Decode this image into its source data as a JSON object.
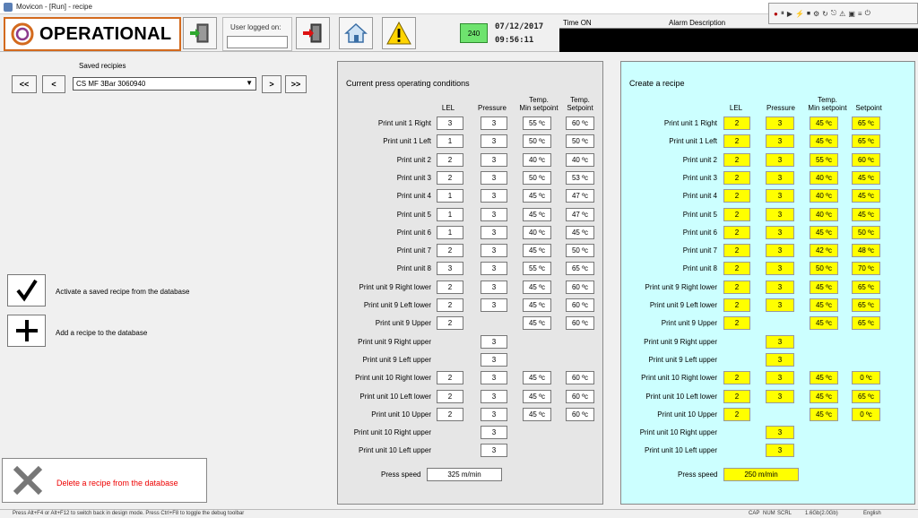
{
  "window": {
    "title": "Movicon - [Run] - recipe"
  },
  "header": {
    "status": "OPERATIONAL",
    "user_label": "User logged on:",
    "user_value": "",
    "code": "240",
    "date": "07/12/2017",
    "time": "09:56:11",
    "alarm_time_header": "Time ON",
    "alarm_desc_header": "Alarm Description"
  },
  "debug": {
    "items": [
      "●",
      "⏸",
      "▶",
      "⚡",
      "⏹",
      "⚙",
      "↻",
      "⎋",
      "⚠",
      "▣",
      "≡",
      "⏻"
    ]
  },
  "icons": {
    "logo": "swirl-logo-icon",
    "login": "login-door-icon",
    "logout": "logout-door-icon",
    "home": "home-icon",
    "alarm": "warning-triangle-icon",
    "check": "checkmark-icon",
    "add": "plus-icon",
    "delete": "cross-icon"
  },
  "colors": {
    "accent": "#d36a1e",
    "code_bg": "#6ee36e",
    "recipe_panel": "#ccffff",
    "recipe_cell": "#ffff00",
    "delete_text": "#e00000"
  },
  "recipes": {
    "saved_label": "Saved recipies",
    "selected": "CS MF 3Bar 3060940",
    "nav": {
      "first": "<<",
      "prev": "<",
      "next": ">",
      "last": ">>"
    }
  },
  "actions": {
    "activate": "Activate a saved recipe from the database",
    "add": "Add a recipe to the database",
    "delete": "Delete a recipe from the database"
  },
  "current": {
    "title": "Current press operating conditions",
    "columns": [
      "LEL",
      "Pressure",
      "Temp.\nMin setpoint",
      "Temp.\nSetpoint"
    ],
    "rows": [
      {
        "label": "Print unit 1 Right",
        "lel": "3",
        "pressure": "3",
        "min": "55 ºc",
        "set": "60 ºc"
      },
      {
        "label": "Print unit 1 Left",
        "lel": "1",
        "pressure": "3",
        "min": "50 ºc",
        "set": "50 ºc"
      },
      {
        "label": "Print unit 2",
        "lel": "2",
        "pressure": "3",
        "min": "40 ºc",
        "set": "40 ºc"
      },
      {
        "label": "Print unit 3",
        "lel": "2",
        "pressure": "3",
        "min": "50 ºc",
        "set": "53 ºc"
      },
      {
        "label": "Print unit 4",
        "lel": "1",
        "pressure": "3",
        "min": "45 ºc",
        "set": "47 ºc"
      },
      {
        "label": "Print unit 5",
        "lel": "1",
        "pressure": "3",
        "min": "45 ºc",
        "set": "47 ºc"
      },
      {
        "label": "Print unit 6",
        "lel": "1",
        "pressure": "3",
        "min": "40 ºc",
        "set": "45 ºc"
      },
      {
        "label": "Print unit 7",
        "lel": "2",
        "pressure": "3",
        "min": "45 ºc",
        "set": "50 ºc"
      },
      {
        "label": "Print unit 8",
        "lel": "3",
        "pressure": "3",
        "min": "55 ºc",
        "set": "65 ºc"
      },
      {
        "label": "Print unit 9 Right lower",
        "lel": "2",
        "pressure": "3",
        "min": "45 ºc",
        "set": "60 ºc"
      },
      {
        "label": "Print unit 9 Left lower",
        "lel": "2",
        "pressure": "3",
        "min": "45 ºc",
        "set": "60 ºc"
      },
      {
        "label": "Print unit 9 Upper",
        "lel": "2",
        "pressure": null,
        "min": "45 ºc",
        "set": "60 ºc"
      },
      {
        "label": "Print unit 9 Right upper",
        "lel": null,
        "pressure": "3",
        "min": null,
        "set": null
      },
      {
        "label": "Print unit 9 Left upper",
        "lel": null,
        "pressure": "3",
        "min": null,
        "set": null
      },
      {
        "label": "Print unit 10 Right lower",
        "lel": "2",
        "pressure": "3",
        "min": "45 ºc",
        "set": "60 ºc"
      },
      {
        "label": "Print unit 10 Left lower",
        "lel": "2",
        "pressure": "3",
        "min": "45 ºc",
        "set": "60 ºc"
      },
      {
        "label": "Print unit 10 Upper",
        "lel": "2",
        "pressure": "3",
        "min": "45 ºc",
        "set": "60 ºc"
      },
      {
        "label": "Print unit 10 Right upper",
        "lel": null,
        "pressure": "3",
        "min": null,
        "set": null
      },
      {
        "label": "Print unit 10 Left upper",
        "lel": null,
        "pressure": "3",
        "min": null,
        "set": null
      }
    ],
    "speed_label": "Press speed",
    "speed_value": "325 m/min"
  },
  "create": {
    "title": "Create a recipe",
    "columns": [
      "LEL",
      "Pressure",
      "Temp.\nMin setpoint",
      "Setpoint"
    ],
    "rows": [
      {
        "label": "Print unit 1 Right",
        "lel": "2",
        "pressure": "3",
        "min": "45 ºc",
        "set": "65 ºc"
      },
      {
        "label": "Print unit 1 Left",
        "lel": "2",
        "pressure": "3",
        "min": "45 ºc",
        "set": "65 ºc"
      },
      {
        "label": "Print unit 2",
        "lel": "2",
        "pressure": "3",
        "min": "55 ºc",
        "set": "60 ºc"
      },
      {
        "label": "Print unit 3",
        "lel": "2",
        "pressure": "3",
        "min": "40 ºc",
        "set": "45 ºc"
      },
      {
        "label": "Print unit 4",
        "lel": "2",
        "pressure": "3",
        "min": "40 ºc",
        "set": "45 ºc"
      },
      {
        "label": "Print unit 5",
        "lel": "2",
        "pressure": "3",
        "min": "40 ºc",
        "set": "45 ºc"
      },
      {
        "label": "Print unit 6",
        "lel": "2",
        "pressure": "3",
        "min": "45 ºc",
        "set": "50 ºc"
      },
      {
        "label": "Print unit 7",
        "lel": "2",
        "pressure": "3",
        "min": "42 ºc",
        "set": "48 ºc"
      },
      {
        "label": "Print unit 8",
        "lel": "2",
        "pressure": "3",
        "min": "50 ºc",
        "set": "70 ºc"
      },
      {
        "label": "Print unit 9 Right lower",
        "lel": "2",
        "pressure": "3",
        "min": "45 ºc",
        "set": "65 ºc"
      },
      {
        "label": "Print unit 9 Left lower",
        "lel": "2",
        "pressure": "3",
        "min": "45 ºc",
        "set": "65 ºc"
      },
      {
        "label": "Print unit 9 Upper",
        "lel": "2",
        "pressure": null,
        "min": "45 ºc",
        "set": "65 ºc"
      },
      {
        "label": "Print unit 9 Right upper",
        "lel": null,
        "pressure": "3",
        "min": null,
        "set": null
      },
      {
        "label": "Print unit 9 Left upper",
        "lel": null,
        "pressure": "3",
        "min": null,
        "set": null
      },
      {
        "label": "Print unit 10 Right lower",
        "lel": "2",
        "pressure": "3",
        "min": "45 ºc",
        "set": "0 ºc"
      },
      {
        "label": "Print unit 10 Left lower",
        "lel": "2",
        "pressure": "3",
        "min": "45 ºc",
        "set": "65 ºc"
      },
      {
        "label": "Print unit 10 Upper",
        "lel": "2",
        "pressure": null,
        "min": "45 ºc",
        "set": "0 ºc"
      },
      {
        "label": "Print unit 10 Right upper",
        "lel": null,
        "pressure": "3",
        "min": null,
        "set": null
      },
      {
        "label": "Print unit 10 Left upper",
        "lel": null,
        "pressure": "3",
        "min": null,
        "set": null
      }
    ],
    "speed_label": "Press speed",
    "speed_value": "250 m/min"
  },
  "status": {
    "hint": "Press Alt+F4 or Alt+F12 to switch back in design mode. Press Ctrl+F8 to toggle the debug toolbar",
    "cap": "CAP",
    "num": "NUM",
    "scrl": "SCRL",
    "mem": "1.6Gb(2.0Gb)",
    "lang": "English"
  }
}
